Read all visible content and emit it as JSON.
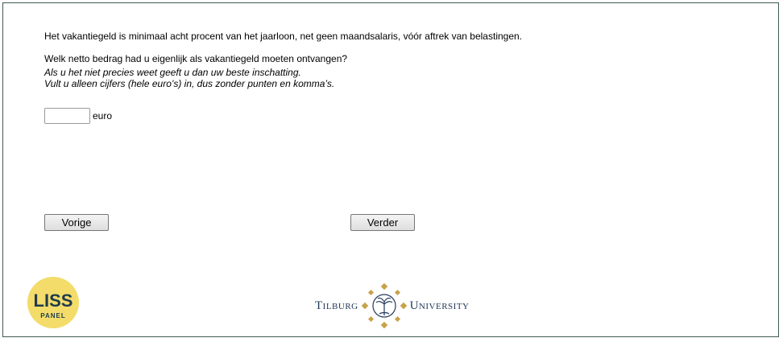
{
  "question": {
    "intro": "Het vakantiegeld is minimaal acht procent van het jaarloon, net geen maandsalaris, vóór aftrek van belastingen.",
    "prompt": "Welk netto bedrag had u eigenlijk als vakantiegeld moeten ontvangen?",
    "hint_line1": "Als u het niet precies weet geeft u dan uw beste inschatting.",
    "hint_line2": "Vult u alleen cijfers (hele euro’s) in, dus zonder punten en komma’s."
  },
  "answer": {
    "value": "",
    "unit": "euro"
  },
  "nav": {
    "prev_label": "Vorige",
    "next_label": "Verder"
  },
  "logos": {
    "liss_top": "LISS",
    "liss_bottom": "PANEL",
    "tilburg_left": "Tilburg",
    "tilburg_right": "University",
    "liss_color": "#f3dc6a",
    "tilburg_color": "#23395b",
    "tilburg_accent": "#c8a24a"
  }
}
